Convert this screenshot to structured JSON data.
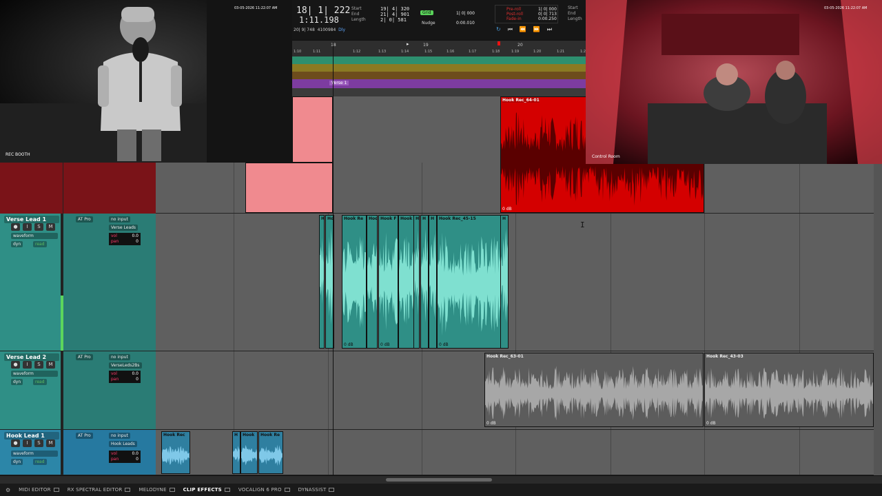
{
  "cams": {
    "booth_label": "REC BOOTH",
    "booth_timestamp": "03-05-2026 11:22:07 AM",
    "control_label": "Control Room",
    "control_timestamp": "03-05-2026 11:22:07 AM"
  },
  "transport": {
    "main_counter": "18| 1| 222",
    "sub_counter": "1:11.198",
    "start_label": "Start",
    "end_label": "End",
    "length_label": "Length",
    "start_val": "19| 4| 320",
    "end_val": "21| 4| 901",
    "length_val": "2| 0| 581",
    "grid_label": "Grid",
    "grid_val": "1| 0| 000",
    "nudge_label": "Nudge",
    "nudge_val": "0:00.010",
    "preroll_label": "Pre-roll",
    "postroll_label": "Post-roll",
    "fadein_label": "Fade-in",
    "preroll_val": "1| 0| 000",
    "postroll_val": "0| 0| 713",
    "fadein_val": "0:00.250",
    "right_start": "Start",
    "right_end": "End",
    "right_length": "Length",
    "info_line": "20| 9| 748",
    "info_samples": "4100984",
    "info_dly": "Dly"
  },
  "ruler": {
    "bars": [
      "18",
      "19",
      "20"
    ],
    "times": [
      "1:10",
      "1:11",
      "1:12",
      "1:13",
      "1:14",
      "1:15",
      "1:16",
      "1:17",
      "1:18",
      "1:19",
      "1:20",
      "1:21",
      "1:2"
    ],
    "marker_label": "Verse 1"
  },
  "tracks": [
    {
      "name": "Verse Lead 1",
      "plugin": "AT Pro",
      "input": "no input",
      "output": "Verse Leads",
      "view": "waveform",
      "dyn": "dyn",
      "read": "read",
      "vol_label": "vol",
      "vol": "0.0",
      "pan_label": "pan",
      "pan": "0",
      "clips": [
        {
          "title": "H",
          "gain": ""
        },
        {
          "title": "Hoo",
          "gain": ""
        },
        {
          "title": "Hook Re",
          "gain": "0 dB"
        },
        {
          "title": "Hoo",
          "gain": ""
        },
        {
          "title": "Hook F",
          "gain": "0 dB"
        },
        {
          "title": "Hook",
          "gain": ""
        },
        {
          "title": "H",
          "gain": ""
        },
        {
          "title": "H",
          "gain": ""
        },
        {
          "title": "H",
          "gain": ""
        },
        {
          "title": "Hook Rec_45-15",
          "gain": "0 dB"
        },
        {
          "title": "H",
          "gain": ""
        }
      ]
    },
    {
      "name": "Verse Lead 2",
      "plugin": "AT Pro",
      "input": "no input",
      "output": "VerseLeds2Bs",
      "view": "waveform",
      "dyn": "dyn",
      "read": "read",
      "vol_label": "vol",
      "vol": "0.0",
      "pan_label": "pan",
      "pan": "0",
      "clips": [
        {
          "title": "Hook Rec_63-01",
          "gain": "0 dB"
        },
        {
          "title": "Hook Rec_43-03",
          "gain": "0 dB"
        }
      ]
    },
    {
      "name": "Hook Lead 1",
      "plugin": "AT Pro",
      "input": "no input",
      "output": "Hook Leads",
      "view": "waveform",
      "dyn": "dyn",
      "read": "read",
      "vol_label": "vol",
      "vol": "0.0",
      "pan_label": "pan",
      "pan": "0",
      "record_label": "record",
      "clips": [
        {
          "title": "Hook Rec",
          "gain": ""
        },
        {
          "title": "H",
          "gain": ""
        },
        {
          "title": "Hook",
          "gain": ""
        },
        {
          "title": "Hook Re",
          "gain": ""
        }
      ]
    }
  ],
  "top_clip": {
    "title": "Hook Rec_64-01",
    "gain": "0 dB"
  },
  "bottom_tabs": [
    {
      "label": "MIDI EDITOR",
      "active": false
    },
    {
      "label": "RX SPECTRAL EDITOR",
      "active": false
    },
    {
      "label": "MELODYNE",
      "active": false
    },
    {
      "label": "CLIP EFFECTS",
      "active": true
    },
    {
      "label": "VOCALIGN 6 PRO",
      "active": false
    },
    {
      "label": "DYNASSIST",
      "active": false
    }
  ],
  "colors": {
    "teal": "#2f8f86",
    "red": "#d40000",
    "pink": "#f08a8f",
    "purple": "#9a45b8",
    "gray_clip": "#5c5c5c"
  }
}
